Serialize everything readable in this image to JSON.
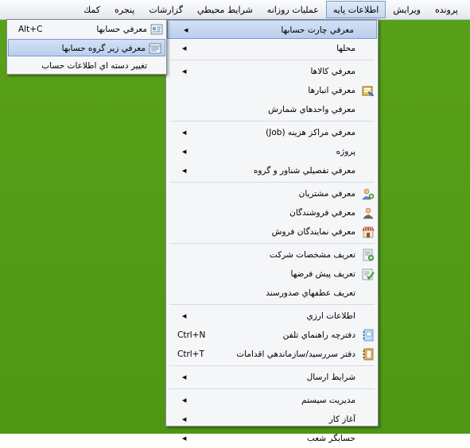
{
  "menubar": {
    "items": [
      "پرونده",
      "ويرايش",
      "اطلاعات پايه",
      "عمليات روزانه",
      "شرايط محيطي",
      "گزارشات",
      "پنجره",
      "كمك"
    ]
  },
  "main_menu": {
    "items": [
      {
        "label": "معرفي چارت حسابها",
        "arrow": "◀"
      },
      {
        "label": "محلها",
        "arrow": "◀"
      },
      {
        "label": "معرفي كالاها",
        "arrow": "◀"
      },
      {
        "label": "معرفي انبارها",
        "icon": "warehouse-icon"
      },
      {
        "label": "معرفي  واحدهاي شمارش"
      },
      {
        "label": "معرفي مراكز هزينه (Job)",
        "arrow": "◀"
      },
      {
        "label": "پروژه",
        "arrow": "◀"
      },
      {
        "label": "معرفي تفصيلي شناور و گروه",
        "arrow": "◀"
      },
      {
        "label": "معرفي مشتريان",
        "icon": "customers-icon"
      },
      {
        "label": "معرفي فروشندگان",
        "icon": "sellers-icon"
      },
      {
        "label": "معرفي نمايندگان فروش",
        "icon": "sales-reps-icon"
      },
      {
        "label": "تعريف مشخصات شركت",
        "icon": "company-icon"
      },
      {
        "label": "تعريف پيش فرضها",
        "icon": "defaults-icon"
      },
      {
        "label": "تعريف عطفهاي صدورسند"
      },
      {
        "label": "اطلاعات ارزي",
        "arrow": "◀"
      },
      {
        "label": "دفترچه راهنماي تلفن",
        "shortcut": "Ctrl+N",
        "icon": "phonebook-icon"
      },
      {
        "label": "دفتر سررسيد/سازماندهي اقدامات",
        "shortcut": "Ctrl+T",
        "icon": "organizer-icon"
      },
      {
        "label": "شرايط ارسال",
        "arrow": "◀"
      },
      {
        "label": "مديريت سيستم",
        "arrow": "◀"
      },
      {
        "label": "آغاز كار",
        "arrow": "◀"
      },
      {
        "label": "حسابگر شعب",
        "arrow": "◀"
      }
    ]
  },
  "sub_menu": {
    "items": [
      {
        "label": "معرفي حسابها",
        "shortcut": "Alt+C",
        "icon": "accounts-icon"
      },
      {
        "label": "معرفي زير گروه حسابها",
        "icon": "subgroup-icon"
      },
      {
        "label": "تغيير دسته اي اطلاعات حساب"
      }
    ]
  },
  "colors": {
    "desktop": "#559d17",
    "highlight": "#b9cfee",
    "menu_bg": "#f5f6f8"
  }
}
